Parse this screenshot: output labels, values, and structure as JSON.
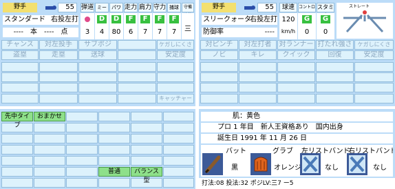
{
  "left": {
    "name_label": "野手",
    "number": "55",
    "batting_form": "スタンダード",
    "throw_bat": "右投左打",
    "record": "----　本　----　点",
    "headers": [
      "弾道",
      "ミート",
      "パワー",
      "走力",
      "肩力",
      "守力",
      "捕球",
      "守備適性"
    ],
    "values": [
      "3",
      "4",
      "80",
      "6",
      "7",
      "7",
      "7",
      "三"
    ],
    "value_letters": [
      "",
      "D",
      "D",
      "F",
      "F",
      "F",
      "F",
      ""
    ],
    "skill_row1": [
      "チャンス",
      "対左投手",
      "サブポジ",
      "",
      "",
      "ケガしにくさ"
    ],
    "skill_row2": [
      "盗塁",
      "走塁",
      "送球",
      "",
      "",
      "安定度"
    ],
    "special": "キャッチャー"
  },
  "right": {
    "name_label": "野手",
    "number": "55",
    "pitch_form": "スリークォーター",
    "throw_bat": "右投左打",
    "era_label": "防御率",
    "era_value": "----",
    "headers": [
      "球速",
      "コントロール",
      "スタミナ"
    ],
    "speed": "120",
    "speed_unit": "km/h",
    "control": "0",
    "stamina": "0",
    "control_letter": "G",
    "stamina_letter": "G",
    "compass_label": "ストレート",
    "skill_row1": [
      "対ピンチ",
      "対左打者",
      "対ランナー",
      "打たれ強さ",
      "ケガしにくさ"
    ],
    "skill_row2": [
      "ノビ",
      "キレ",
      "クイック",
      "回復",
      "安定度"
    ]
  },
  "bottom_left": {
    "tags": [
      "先中タイプ",
      "おまかせ",
      "普通",
      "バランス型"
    ]
  },
  "profile": {
    "skin": "肌：黄色",
    "career": "プロ 1 年目　新人王資格あり　国内出身",
    "birthday": "誕生日 1991 年 11 月 26 日"
  },
  "equipment": {
    "bat_label": "バット",
    "glove_label": "グラブ",
    "left_band_label": "左リストバンド",
    "right_band_label": "右リストバンド",
    "bat_value": "黒",
    "glove_value": "オレンジ",
    "left_band_value": "なし",
    "right_band_value": "なし"
  },
  "footer": "打法:08 投法:32 ポジLV:三7 ー5",
  "colors": {
    "panel": "#bcdcf8",
    "cell": "#ddf2fc",
    "tab": "#f3e070",
    "green": "#8ee08a"
  }
}
